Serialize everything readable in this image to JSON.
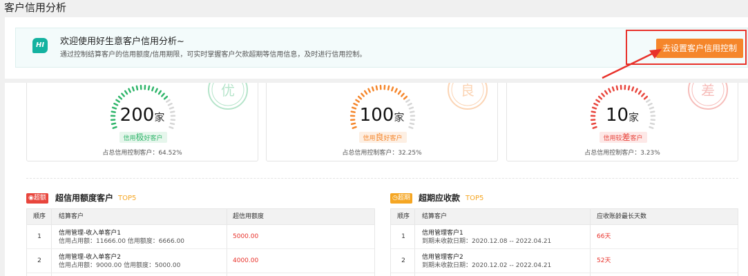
{
  "page": {
    "title": "客户信用分析"
  },
  "banner": {
    "hi": "HI",
    "welcome": "欢迎使用好生意客户信用分析~",
    "desc": "通过控制结算客户的信用额度/信用期限，可实时掌握客户欠款超期等信用信息，及时进行信用控制。",
    "button_label": "去设置客户信用控制"
  },
  "stats": [
    {
      "count": "200",
      "unit": "家",
      "stamp": "优",
      "tag_prefix": "信用",
      "tag_big": "极",
      "tag_suffix": "好客户",
      "percent_label": "占总信用控制客户：64.52%",
      "color": "#2fb56a",
      "tag_bg": "#e6f6ec"
    },
    {
      "count": "100",
      "unit": "家",
      "stamp": "良",
      "tag_prefix": "信用",
      "tag_big": "良",
      "tag_suffix": "好客户",
      "percent_label": "占总信用控制客户：32.25%",
      "color": "#f5862b",
      "tag_bg": "#fdefe3"
    },
    {
      "count": "10",
      "unit": "家",
      "stamp": "差",
      "tag_prefix": "信用较",
      "tag_big": "差",
      "tag_suffix": "客户",
      "percent_label": "占总信用控制客户：3.23%",
      "color": "#e8453c",
      "tag_bg": "#fde8e7"
    }
  ],
  "over_limit": {
    "badge": "超额",
    "badge_color": "#e8453c",
    "title": "超信用额度客户",
    "top": "TOP5",
    "headers": [
      "顺序",
      "结算客户",
      "超信用额度"
    ],
    "rows": [
      {
        "idx": "1",
        "name": "信用管理-收入单客户1",
        "sub": "信用占用额：11666.00   信用额度：6666.00",
        "value": "5000.00"
      },
      {
        "idx": "2",
        "name": "信用管理-收入单客户2",
        "sub": "信用占用额：9000.00   信用额度：5000.00",
        "value": "4000.00"
      }
    ]
  },
  "overdue": {
    "badge": "超期",
    "badge_color": "#f5a623",
    "title": "超期应收款",
    "top": "TOP5",
    "headers": [
      "顺序",
      "结算客户",
      "应收账龄最长天数"
    ],
    "rows": [
      {
        "idx": "1",
        "name": "信用管理客户1",
        "sub": "到期未收款日期：2020.12.08 -- 2022.04.21",
        "value": "66天"
      },
      {
        "idx": "2",
        "name": "信用管理客户2",
        "sub": "到期未收款日期：2020.12.02 -- 2022.04.21",
        "value": "52天"
      }
    ]
  }
}
